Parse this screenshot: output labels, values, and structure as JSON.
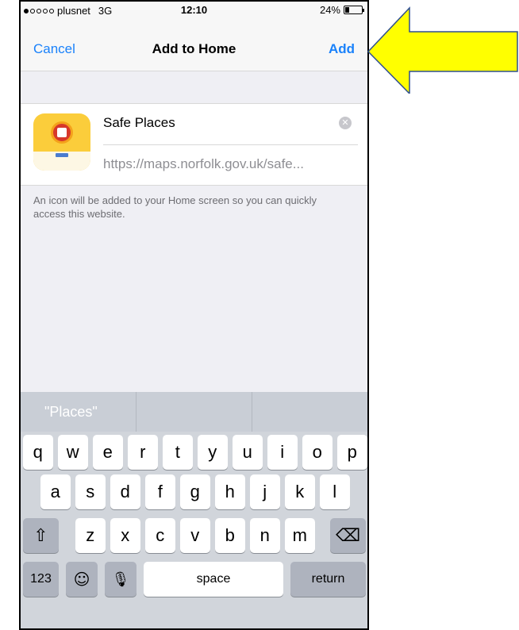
{
  "status_bar": {
    "carrier": "plusnet",
    "network": "3G",
    "time": "12:10",
    "battery_percent": "24%",
    "battery_level": 0.24,
    "signal_bars": 1
  },
  "nav": {
    "cancel_label": "Cancel",
    "title": "Add to Home",
    "add_label": "Add"
  },
  "form": {
    "name_value": "Safe Places",
    "url_text": "https://maps.norfolk.gov.uk/safe...",
    "hint_text": "An icon will be added to your Home screen so you can quickly access this website."
  },
  "keyboard": {
    "suggestions": [
      "\"Places\"",
      "",
      ""
    ],
    "row1": [
      "q",
      "w",
      "e",
      "r",
      "t",
      "y",
      "u",
      "i",
      "o",
      "p"
    ],
    "row2": [
      "a",
      "s",
      "d",
      "f",
      "g",
      "h",
      "j",
      "k",
      "l"
    ],
    "row3": [
      "z",
      "x",
      "c",
      "v",
      "b",
      "n",
      "m"
    ],
    "numbers_label": "123",
    "space_label": "space",
    "return_label": "return"
  },
  "colors": {
    "accent": "#1a82fb",
    "arrow_fill": "#ffff00",
    "arrow_stroke": "#2f4f8f"
  }
}
